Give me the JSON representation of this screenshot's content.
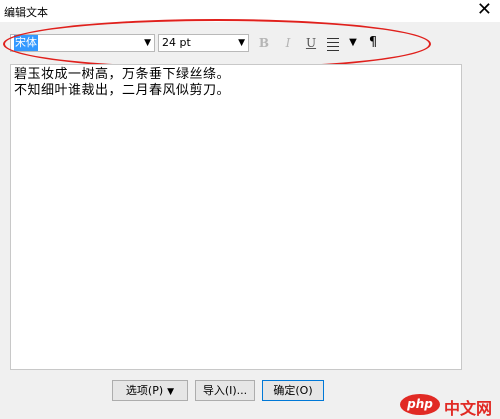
{
  "window": {
    "title": "编辑文本",
    "close_symbol": "✕"
  },
  "toolbar": {
    "font_value": "宋体",
    "font_dropdown_arrow": "▼",
    "size_value": "24 pt",
    "size_dropdown_arrow": "▼",
    "bold_label": "B",
    "italic_label": "I",
    "underline_label": "U",
    "align_dropdown_arrow": "▼",
    "paragraph_symbol": "¶"
  },
  "editor": {
    "lines": [
      "碧玉妆成一树高，万条垂下绿丝绦。",
      "不知细叶谁裁出，二月春风似剪刀。"
    ]
  },
  "footer": {
    "options_label": "选项(P)",
    "options_arrow": "▼",
    "import_label": "导入(I)...",
    "ok_label": "确定(O)"
  },
  "watermark": {
    "badge": "php",
    "site": "中文网"
  },
  "colors": {
    "highlight_ellipse": "#e0201c",
    "selection": "#3399ff",
    "watermark": "#e12a24"
  }
}
